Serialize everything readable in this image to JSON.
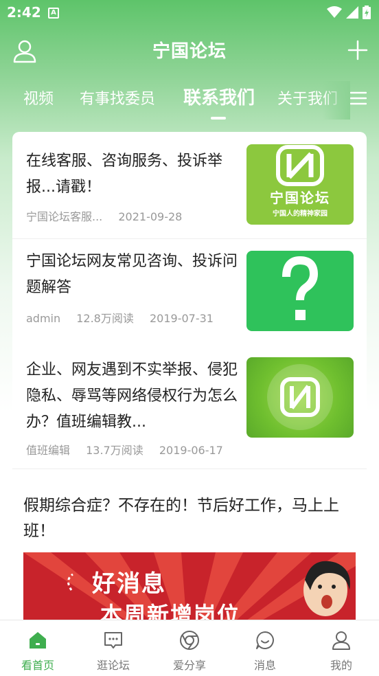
{
  "status_bar": {
    "time": "2:42",
    "notification_letter": "A"
  },
  "header": {
    "title": "宁国论坛"
  },
  "tabs": [
    {
      "label": "视频"
    },
    {
      "label": "有事找委员"
    },
    {
      "label": "联系我们",
      "active": true
    },
    {
      "label": "关于我们"
    }
  ],
  "articles": [
    {
      "title": "在线客服、咨询服务、投诉举报...请戳！",
      "author": "宁国论坛客服...",
      "reads": "",
      "date": "2021-09-28",
      "thumb_text": "宁国论坛",
      "thumb_subtext": "宁国人的精神家园"
    },
    {
      "title": "宁国论坛网友常见咨询、投诉问题解答",
      "author": "admin",
      "reads": "12.8万阅读",
      "date": "2019-07-31"
    },
    {
      "title": "企业、网友遇到不实举报、侵犯隐私、辱骂等网络侵权行为怎么办？值班编辑教...",
      "author": "值班编辑",
      "reads": "13.7万阅读",
      "date": "2019-06-17"
    }
  ],
  "feature": {
    "title": "假期综合症？不存在的！节后好工作，马上上班！",
    "banner_line1": "好消息",
    "banner_line2": "本周新增岗位"
  },
  "bottom_nav": [
    {
      "label": "看首页",
      "icon": "home-icon",
      "active": true
    },
    {
      "label": "逛论坛",
      "icon": "forum-icon"
    },
    {
      "label": "爱分享",
      "icon": "share-icon"
    },
    {
      "label": "消息",
      "icon": "message-icon"
    },
    {
      "label": "我的",
      "icon": "profile-icon"
    }
  ],
  "colors": {
    "brand_green": "#3fae4f",
    "header_green": "#5ec46a",
    "thumb_green": "#2fc25b",
    "banner_red": "#c8232b"
  }
}
